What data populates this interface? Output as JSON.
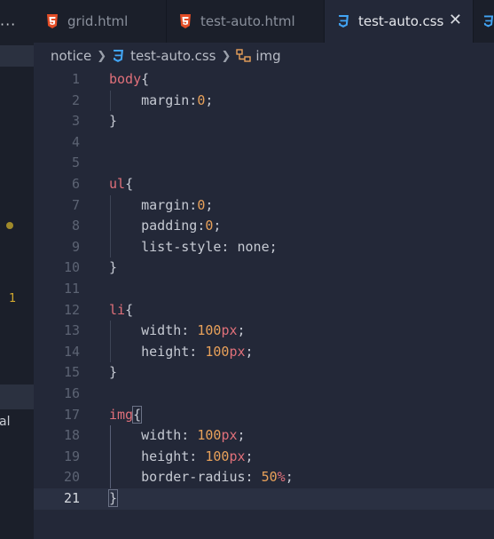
{
  "sidebar": {
    "menu": "···",
    "problem_count": "1",
    "name_fragment": "al"
  },
  "tabs": [
    {
      "label": "grid.html",
      "icon": "html5-icon",
      "active": false
    },
    {
      "label": "test-auto.html",
      "icon": "html5-icon",
      "active": false
    },
    {
      "label": "test-auto.css",
      "icon": "css3-icon",
      "active": true
    }
  ],
  "breadcrumb": {
    "folder": "notice",
    "file": "test-auto.css",
    "symbol": "img"
  },
  "editor": {
    "current_line": 21,
    "lines": [
      {
        "n": "1",
        "parts": [
          [
            "sel",
            "body"
          ],
          [
            "p",
            "{"
          ]
        ]
      },
      {
        "n": "2",
        "parts": [
          [
            "p",
            "    margin:"
          ],
          [
            "num",
            "0"
          ],
          [
            "p",
            ";"
          ]
        ]
      },
      {
        "n": "3",
        "parts": [
          [
            "p",
            "}"
          ]
        ]
      },
      {
        "n": "4",
        "parts": []
      },
      {
        "n": "5",
        "parts": []
      },
      {
        "n": "6",
        "parts": [
          [
            "sel",
            "ul"
          ],
          [
            "p",
            "{"
          ]
        ]
      },
      {
        "n": "7",
        "parts": [
          [
            "p",
            "    margin:"
          ],
          [
            "num",
            "0"
          ],
          [
            "p",
            ";"
          ]
        ]
      },
      {
        "n": "8",
        "parts": [
          [
            "p",
            "    padding:"
          ],
          [
            "num",
            "0"
          ],
          [
            "p",
            ";"
          ]
        ]
      },
      {
        "n": "9",
        "parts": [
          [
            "p",
            "    list-style: none;"
          ]
        ]
      },
      {
        "n": "10",
        "parts": [
          [
            "p",
            "}"
          ]
        ]
      },
      {
        "n": "11",
        "parts": []
      },
      {
        "n": "12",
        "parts": [
          [
            "sel",
            "li"
          ],
          [
            "p",
            "{"
          ]
        ]
      },
      {
        "n": "13",
        "parts": [
          [
            "p",
            "    width: "
          ],
          [
            "num",
            "100"
          ],
          [
            "unit",
            "px"
          ],
          [
            "p",
            ";"
          ]
        ]
      },
      {
        "n": "14",
        "parts": [
          [
            "p",
            "    height: "
          ],
          [
            "num",
            "100"
          ],
          [
            "unit",
            "px"
          ],
          [
            "p",
            ";"
          ]
        ]
      },
      {
        "n": "15",
        "parts": [
          [
            "p",
            "}"
          ]
        ]
      },
      {
        "n": "16",
        "parts": []
      },
      {
        "n": "17",
        "parts": [
          [
            "sel",
            "img"
          ],
          [
            "hi",
            "{"
          ]
        ]
      },
      {
        "n": "18",
        "parts": [
          [
            "p",
            "    width: "
          ],
          [
            "num",
            "100"
          ],
          [
            "unit",
            "px"
          ],
          [
            "p",
            ";"
          ]
        ]
      },
      {
        "n": "19",
        "parts": [
          [
            "p",
            "    height: "
          ],
          [
            "num",
            "100"
          ],
          [
            "unit",
            "px"
          ],
          [
            "p",
            ";"
          ]
        ]
      },
      {
        "n": "20",
        "parts": [
          [
            "p",
            "    border-radius: "
          ],
          [
            "num",
            "50"
          ],
          [
            "unit",
            "%"
          ],
          [
            "p",
            ";"
          ]
        ]
      },
      {
        "n": "21",
        "parts": [
          [
            "hi",
            "}"
          ]
        ]
      }
    ]
  },
  "colors": {
    "background": "#232838",
    "selector": "#e0707a",
    "number": "#e8a15a",
    "html_icon": "#e44d26",
    "css_icon": "#42a5f5"
  }
}
